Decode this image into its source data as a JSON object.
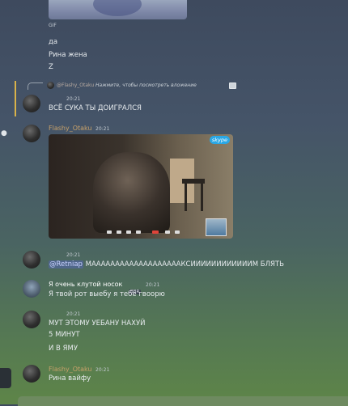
{
  "top": {
    "gif_label": "GIF",
    "lines": [
      "да",
      "Рина жена",
      "Z"
    ]
  },
  "reply": {
    "author": "@Flashy_Otaku",
    "hint": "Нажмите, чтобы посмотреть вложение"
  },
  "messages": [
    {
      "author": "",
      "time": "20:21",
      "lines": [
        "ВСЁ СУКА ТЫ ДОИГРАЛСЯ"
      ]
    },
    {
      "author": "Flashy_Otaku",
      "time": "20:21",
      "video_badge": "skype"
    },
    {
      "author": "",
      "time": "20:21",
      "mention": "@Retniap",
      "text": "МАААААААААААААААААААКСИИИИИИИИИИИИМ БЛЯТЬ"
    },
    {
      "author": "Я очень клутой носок",
      "tag": "BBR",
      "time": "20:21",
      "lines": [
        "Я твой рот выебу я тебе гвоорю"
      ]
    },
    {
      "author": "",
      "time": "20:21",
      "lines": [
        "МУТ ЭТОМУ УЕБАНУ НАХУЙ",
        "5 МИНУТ",
        "И В ЯМУ"
      ]
    },
    {
      "author": "Flashy_Otaku",
      "time": "20:21",
      "lines": [
        "Рина вайфу"
      ]
    }
  ],
  "colors": {
    "accent_name": "#c8a16a",
    "reply_bar": "#d9b24a",
    "mention_bg": "#5865f2",
    "author_white": "#ffffff"
  }
}
